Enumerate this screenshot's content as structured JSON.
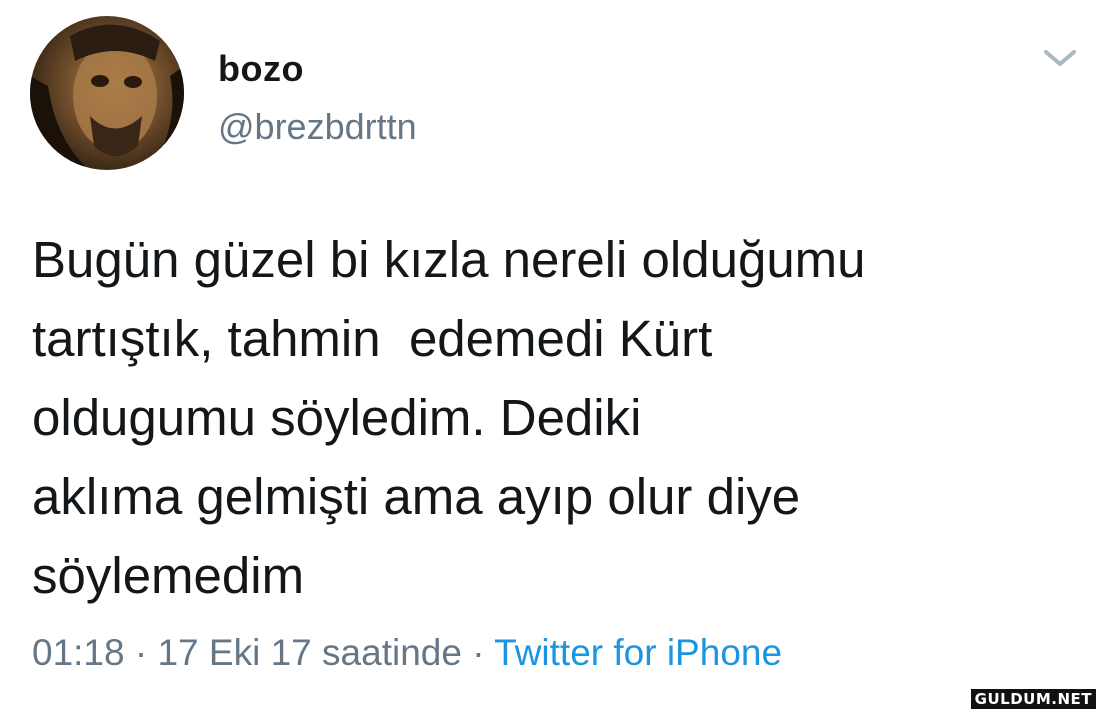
{
  "tweet": {
    "display_name": "bozo",
    "handle": "@brezbdrttn",
    "text_lines": [
      "Bugün güzel bi kızla nereli olduğumu",
      "tartıştık, tahmin  edemedi Kürt",
      "oldugumu söyledim. Dediki",
      "aklıma gelmişti ama ayıp olur diye",
      "söylemedim"
    ],
    "time": "01:18",
    "separator": " · ",
    "date": "17 Eki 17 saatinde",
    "source": "Twitter for iPhone",
    "menu_icon": "chevron-down-icon"
  },
  "watermark": "GULDUM.NET",
  "colors": {
    "text": "#14171a",
    "secondary": "#657786",
    "link": "#1b95e0",
    "background": "#ffffff"
  }
}
